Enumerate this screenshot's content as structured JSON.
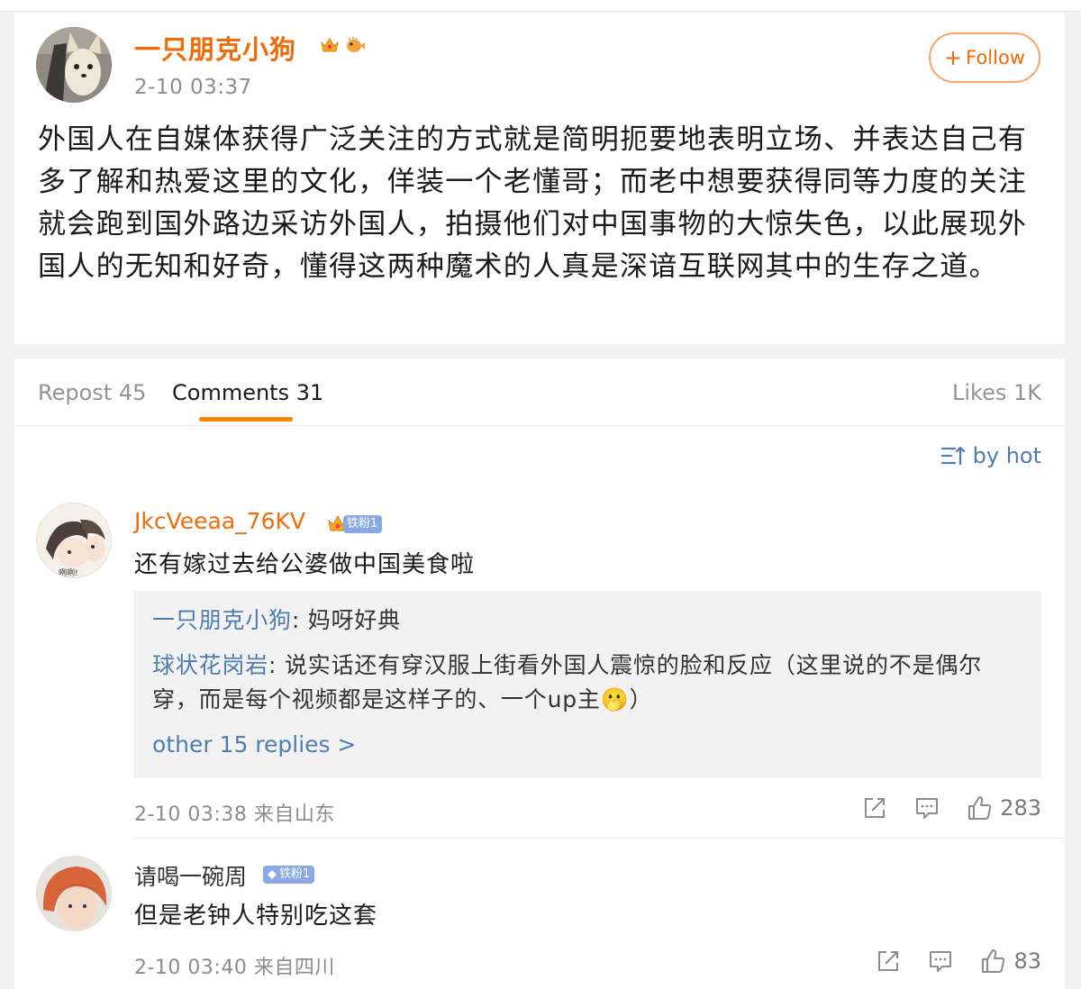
{
  "post": {
    "author": "一只朋克小狗",
    "time": "2-10 03:37",
    "follow_label": "Follow",
    "body": "外国人在自媒体获得广泛关注的方式就是简明扼要地表明立场、并表达自己有多了解和热爱这里的文化，佯装一个老懂哥；而老中想要获得同等力度的关注就会跑到国外路边采访外国人，拍摄他们对中国事物的大惊失色，以此展现外国人的无知和好奇，懂得这两种魔术的人真是深谙互联网其中的生存之道。"
  },
  "tabs": {
    "repost": "Repost 45",
    "comments": "Comments 31",
    "likes": "Likes 1K"
  },
  "sort_label": "by hot",
  "comments": [
    {
      "user": "JkcVeeaa_76KV",
      "fan_badge": "铁粉1",
      "text": "还有嫁过去给公婆做中国美食啦",
      "avatar_caption": "咧咧!",
      "replies": [
        {
          "user": "一只朋克小狗",
          "text": ": 妈呀好典"
        },
        {
          "user": "球状花岗岩",
          "text": ": 说实话还有穿汉服上街看外国人震惊的脸和反应（这里说的不是偶尔穿，而是每个视频都是这样子的、一个up主🫢）"
        }
      ],
      "more_replies": "other 15 replies >",
      "time": "2-10 03:38",
      "location": "来自山东",
      "likes": "283"
    },
    {
      "user": "请喝一碗周",
      "fan_badge": "铁粉1",
      "text": "但是老钟人特别吃这套",
      "time": "2-10 03:40",
      "location": "来自四川",
      "likes": "83"
    }
  ],
  "colors": {
    "accent": "#f26b0a",
    "link": "#4f7db0",
    "tab_underline": "#ff8200"
  },
  "icons": [
    "crown-icon",
    "pufferfish-icon",
    "plus-icon",
    "sort-icon",
    "share-icon",
    "comment-icon",
    "thumbs-up-icon",
    "diamond-icon"
  ]
}
